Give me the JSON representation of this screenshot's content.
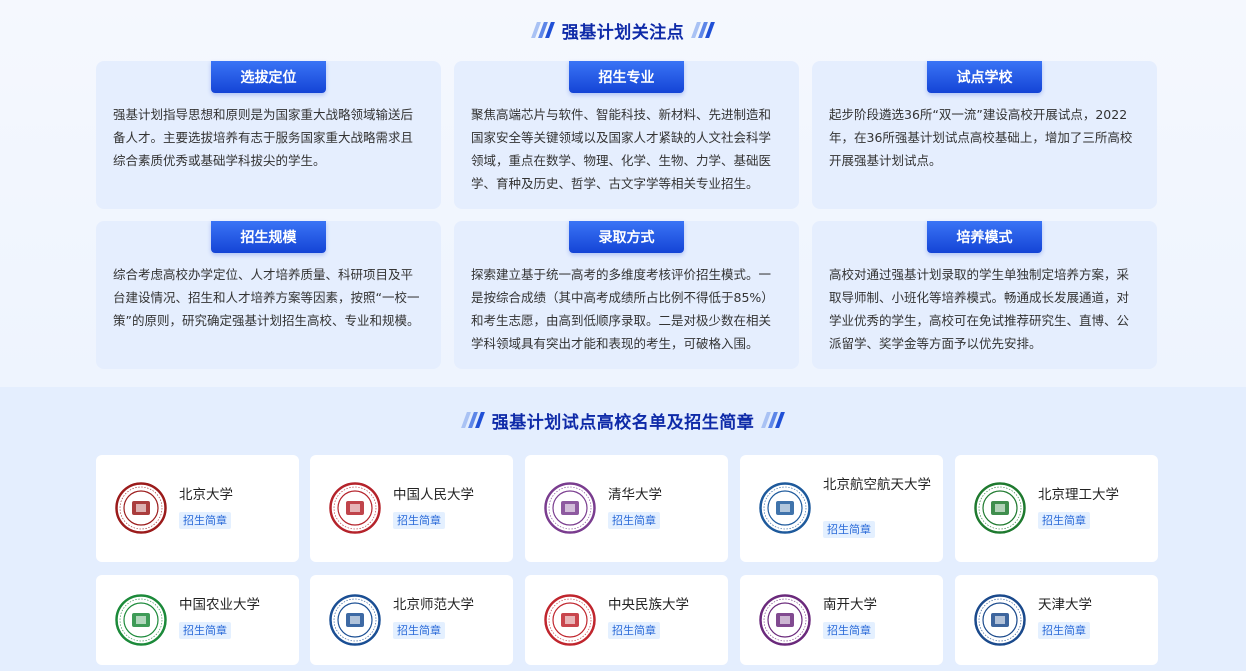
{
  "focus": {
    "title": "强基计划关注点",
    "cards": [
      {
        "title": "选拔定位",
        "text": "强基计划指导思想和原则是为国家重大战略领域输送后备人才。主要选拔培养有志于服务国家重大战略需求且综合素质优秀或基础学科拔尖的学生。"
      },
      {
        "title": "招生专业",
        "text": "聚焦高端芯片与软件、智能科技、新材料、先进制造和国家安全等关键领域以及国家人才紧缺的人文社会科学领域，重点在数学、物理、化学、生物、力学、基础医学、育种及历史、哲学、古文字学等相关专业招生。"
      },
      {
        "title": "试点学校",
        "text": "起步阶段遴选36所“双一流”建设高校开展试点，2022年，在36所强基计划试点高校基础上，增加了三所高校开展强基计划试点。"
      },
      {
        "title": "招生规模",
        "text": "综合考虑高校办学定位、人才培养质量、科研项目及平台建设情况、招生和人才培养方案等因素，按照“一校一策”的原则，研究确定强基计划招生高校、专业和规模。"
      },
      {
        "title": "录取方式",
        "text": "探索建立基于统一高考的多维度考核评价招生模式。一是按综合成绩（其中高考成绩所占比例不得低于85%）和考生志愿，由高到低顺序录取。二是对极少数在相关学科领域具有突出才能和表现的考生，可破格入围。"
      },
      {
        "title": "培养模式",
        "text": "高校对通过强基计划录取的学生单独制定培养方案，采取导师制、小班化等培养模式。畅通成长发展通道，对学业优秀的学生，高校可在免试推荐研究生、直博、公派留学、奖学金等方面予以优先安排。"
      }
    ]
  },
  "universities": {
    "title": "强基计划试点高校名单及招生简章",
    "tag_label": "招生简章",
    "items": [
      {
        "name": "北京大学",
        "logo_color": "#9b1b1b",
        "logo_icon": "pku-seal-icon"
      },
      {
        "name": "中国人民大学",
        "logo_color": "#b5232b",
        "logo_icon": "ruc-seal-icon"
      },
      {
        "name": "清华大学",
        "logo_color": "#7a3d8f",
        "logo_icon": "tsinghua-seal-icon"
      },
      {
        "name": "北京航空航天大学",
        "logo_color": "#1e5a9c",
        "logo_icon": "buaa-seal-icon"
      },
      {
        "name": "北京理工大学",
        "logo_color": "#1f7a2f",
        "logo_icon": "bit-seal-icon"
      },
      {
        "name": "中国农业大学",
        "logo_color": "#1c8a3a",
        "logo_icon": "cau-seal-icon"
      },
      {
        "name": "北京师范大学",
        "logo_color": "#1b4f94",
        "logo_icon": "bnu-seal-icon"
      },
      {
        "name": "中央民族大学",
        "logo_color": "#c0262e",
        "logo_icon": "muc-seal-icon"
      },
      {
        "name": "南开大学",
        "logo_color": "#6b2a7c",
        "logo_icon": "nankai-seal-icon"
      },
      {
        "name": "天津大学",
        "logo_color": "#1b4a8c",
        "logo_icon": "tju-seal-icon"
      }
    ]
  }
}
